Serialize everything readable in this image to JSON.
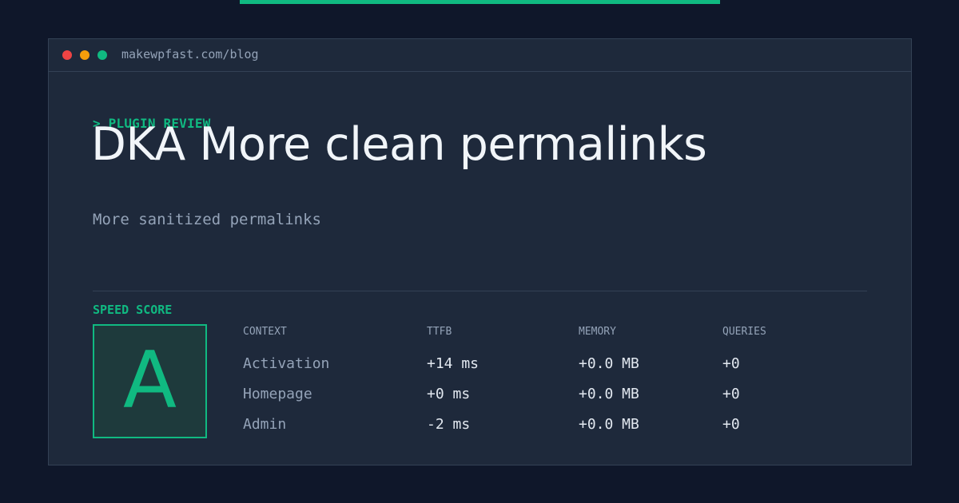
{
  "colors": {
    "background": "#0f172a",
    "card": "#1e293b",
    "border": "#334155",
    "accent": "#10b981",
    "text": "#f1f5f9",
    "muted": "#94a3b8"
  },
  "window": {
    "url": "makewpfast.com/blog"
  },
  "article": {
    "eyebrow": "> PLUGIN REVIEW",
    "title": "DKA More clean permalinks",
    "subtitle": "More sanitized permalinks"
  },
  "score": {
    "label": "SPEED SCORE",
    "grade": "A"
  },
  "table": {
    "headers": [
      "CONTEXT",
      "TTFB",
      "MEMORY",
      "QUERIES"
    ],
    "rows": [
      [
        "Activation",
        "+14 ms",
        "+0.0 MB",
        "+0"
      ],
      [
        "Homepage",
        "+0 ms",
        "+0.0 MB",
        "+0"
      ],
      [
        "Admin",
        "-2 ms",
        "+0.0 MB",
        "+0"
      ]
    ]
  }
}
